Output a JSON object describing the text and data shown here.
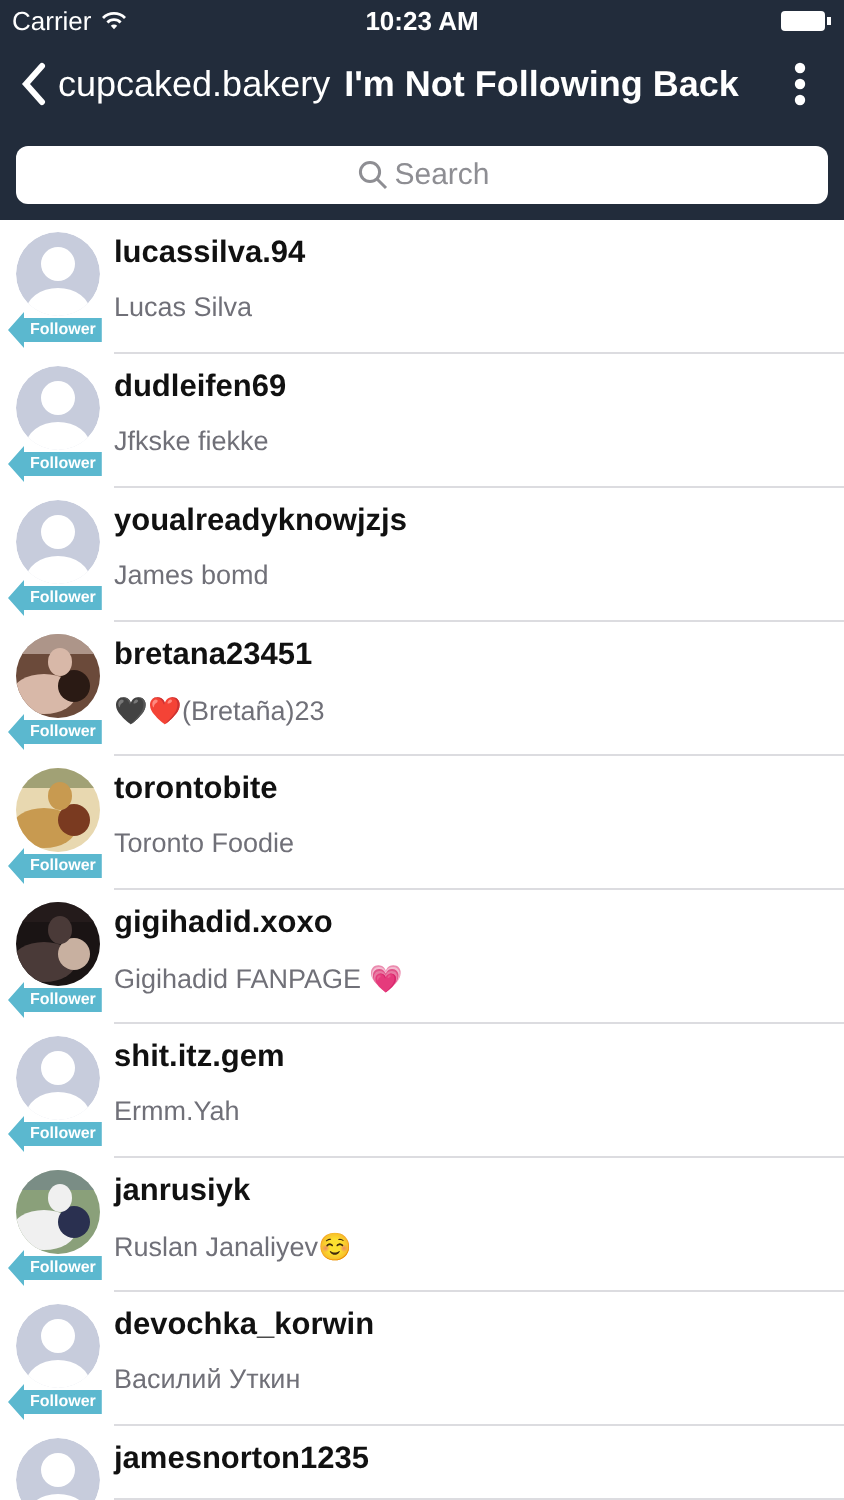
{
  "status_bar": {
    "carrier": "Carrier",
    "time": "10:23 AM"
  },
  "nav_bar": {
    "back_label": "cupcaked.bakery",
    "title": "I'm Not Following Back"
  },
  "search": {
    "placeholder": "Search"
  },
  "users": [
    {
      "username": "lucassilva.94",
      "full_name": "Lucas Silva",
      "badge": "Follower",
      "has_photo": false
    },
    {
      "username": "dudleifen69",
      "full_name": "Jfkske fiekke",
      "badge": "Follower",
      "has_photo": false
    },
    {
      "username": "youalreadyknowjzjs",
      "full_name": "James bomd",
      "badge": "Follower",
      "has_photo": false
    },
    {
      "username": "bretana23451",
      "full_name": "🖤❤️(Bretaña)23",
      "badge": "Follower",
      "has_photo": true
    },
    {
      "username": "torontobite",
      "full_name": "Toronto Foodie",
      "badge": "Follower",
      "has_photo": true
    },
    {
      "username": "gigihadid.xoxo",
      "full_name": "Gigihadid FANPAGE 💗",
      "badge": "Follower",
      "has_photo": true
    },
    {
      "username": "shit.itz.gem",
      "full_name": "Ermm.Yah",
      "badge": "Follower",
      "has_photo": false
    },
    {
      "username": "janrusiyk",
      "full_name": "Ruslan Janaliyev☺️",
      "badge": "Follower",
      "has_photo": true
    },
    {
      "username": "devochka_korwin",
      "full_name": "Василий Уткин",
      "badge": "Follower",
      "has_photo": false
    },
    {
      "username": "jamesnorton1235",
      "has_photo": false
    }
  ]
}
